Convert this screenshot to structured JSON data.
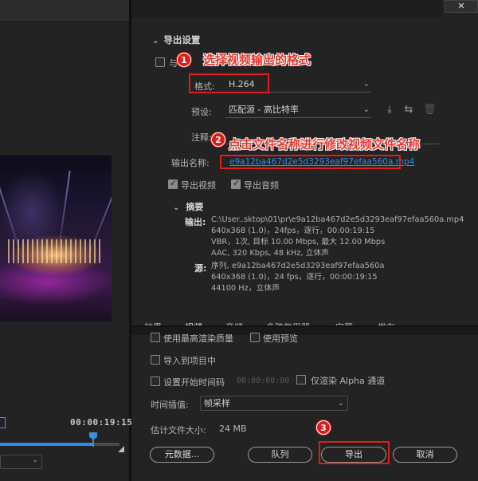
{
  "window": {
    "close_label": "✕"
  },
  "preview": {
    "timecode": "00:00:19:15",
    "scrubber_progress": 0.78
  },
  "export_settings": {
    "section_title": "导出设置",
    "match_sequence_label": "与",
    "format_label": "格式:",
    "format_value": "H.264",
    "preset_label": "预设:",
    "preset_value": "匹配源 - 高比特率",
    "comments_label": "注释:",
    "output_name_label": "输出名称:",
    "output_name_value": "e9a12ba467d2e5d3293eaf97efaa560a.mp4",
    "export_video_label": "导出视频",
    "export_audio_label": "导出音频",
    "export_video_checked": true,
    "export_audio_checked": true
  },
  "summary": {
    "title": "摘要",
    "output_label": "输出:",
    "output_lines": [
      "C:\\User..sktop\\01\\pr\\e9a12ba467d2e5d3293eaf97efaa560a.mp4",
      "640x368 (1.0)，24fps，逐行，00:00:19:15",
      "VBR，1次, 目标 10.00 Mbps, 最大 12.00 Mbps",
      "AAC, 320 Kbps, 48 kHz, 立体声"
    ],
    "source_label": "源:",
    "source_lines": [
      "序列, e9a12ba467d2e5d3293eaf97efaa560a",
      "640x368 (1.0)，24 fps，逐行，00:00:19:15",
      "44100 Hz，立体声"
    ]
  },
  "tabs": [
    "效果",
    "视频",
    "音频",
    "多路复用器",
    "字幕",
    "发布"
  ],
  "options": {
    "max_render_quality": "使用最高渲染质量",
    "use_previews": "使用预览",
    "import_into_project": "导入到项目中",
    "set_start_timecode": "设置开始时间码",
    "start_timecode_value": "00:00:00:00",
    "render_alpha_only": "仅渲染 Alpha 通道",
    "time_interpolation_label": "时间插值:",
    "time_interpolation_value": "帧采样",
    "estimated_size_label": "估计文件大小:",
    "estimated_size_value": "24 MB"
  },
  "buttons": {
    "metadata": "元数据...",
    "queue": "队列",
    "export": "导出",
    "cancel": "取消"
  },
  "callouts": [
    {
      "num": "1",
      "text": "选择视频输出的格式"
    },
    {
      "num": "2",
      "text": "点击文件名称进行修改视频文件名称"
    },
    {
      "num": "3",
      "text": ""
    }
  ],
  "colors": {
    "accent": "#2d8ceb",
    "annotation_red": "#e21c1c"
  }
}
